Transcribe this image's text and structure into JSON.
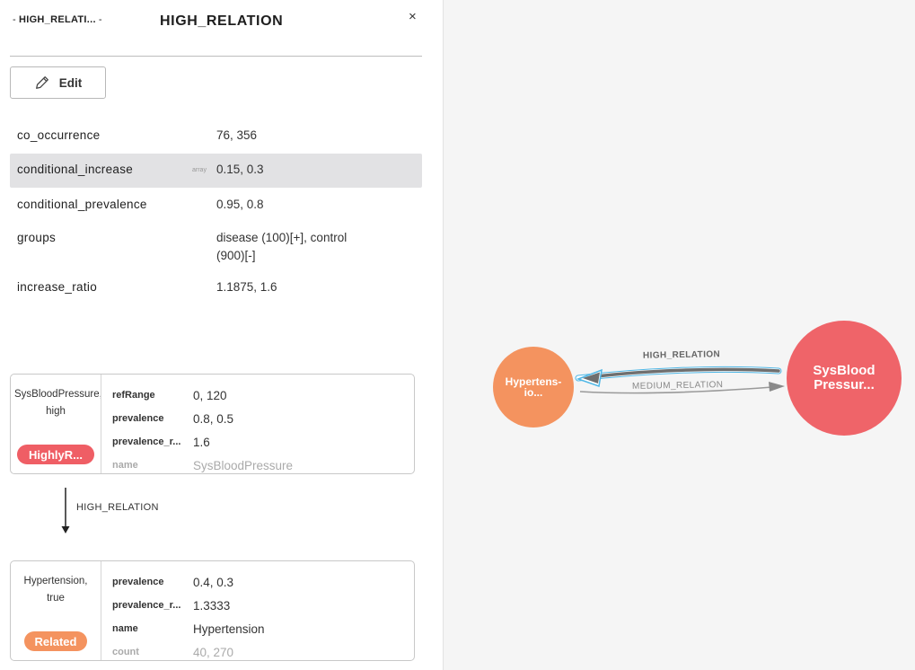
{
  "header": {
    "breadcrumb": "HIGH_RELATI...",
    "breadcrumb_dash": "-",
    "title": "HIGH_RELATION",
    "close_glyph": "×"
  },
  "toolbar": {
    "edit_label": "Edit",
    "edit_icon": "pencil-icon"
  },
  "properties": [
    {
      "key": "co_occurrence",
      "value": "76, 356"
    },
    {
      "key": "conditional_increase",
      "value": "0.15, 0.3",
      "type_tag": "array",
      "selected": true
    },
    {
      "key": "conditional_prevalence",
      "value": "0.95, 0.8"
    },
    {
      "key": "groups",
      "value": "disease (100)[+], control (900)[-]"
    },
    {
      "key": "increase_ratio",
      "value": "1.1875, 1.6"
    }
  ],
  "source_card": {
    "title": "SysBloodPressure,",
    "subtitle": "high",
    "badge": "HighlyR...",
    "badge_color": "#ef5e65",
    "rows": [
      {
        "key": "refRange",
        "value": "0, 120"
      },
      {
        "key": "prevalence",
        "value": "0.8, 0.5"
      },
      {
        "key": "prevalence_r...",
        "value": "1.6"
      },
      {
        "key": "name",
        "value": "SysBloodPressure"
      }
    ]
  },
  "relation": {
    "label": "HIGH_RELATION"
  },
  "target_card": {
    "title": "Hypertension,",
    "subtitle": "true",
    "badge": "Related",
    "badge_color": "#f4935f",
    "rows": [
      {
        "key": "prevalence",
        "value": "0.4, 0.3"
      },
      {
        "key": "prevalence_r...",
        "value": "1.3333"
      },
      {
        "key": "name",
        "value": "Hypertension"
      },
      {
        "key": "count",
        "value": "40, 270"
      }
    ]
  },
  "graph": {
    "node_a": {
      "label": "Hypertens-\nio...",
      "color": "#f4935f"
    },
    "node_b": {
      "label": "SysBlood\nPressur...",
      "color": "#ef6469"
    },
    "edge_high": {
      "label": "HIGH_RELATION",
      "color": "#777777",
      "highlight": "#4fb7e6"
    },
    "edge_medium": {
      "label": "MEDIUM_RELATION",
      "color": "#999999"
    }
  }
}
